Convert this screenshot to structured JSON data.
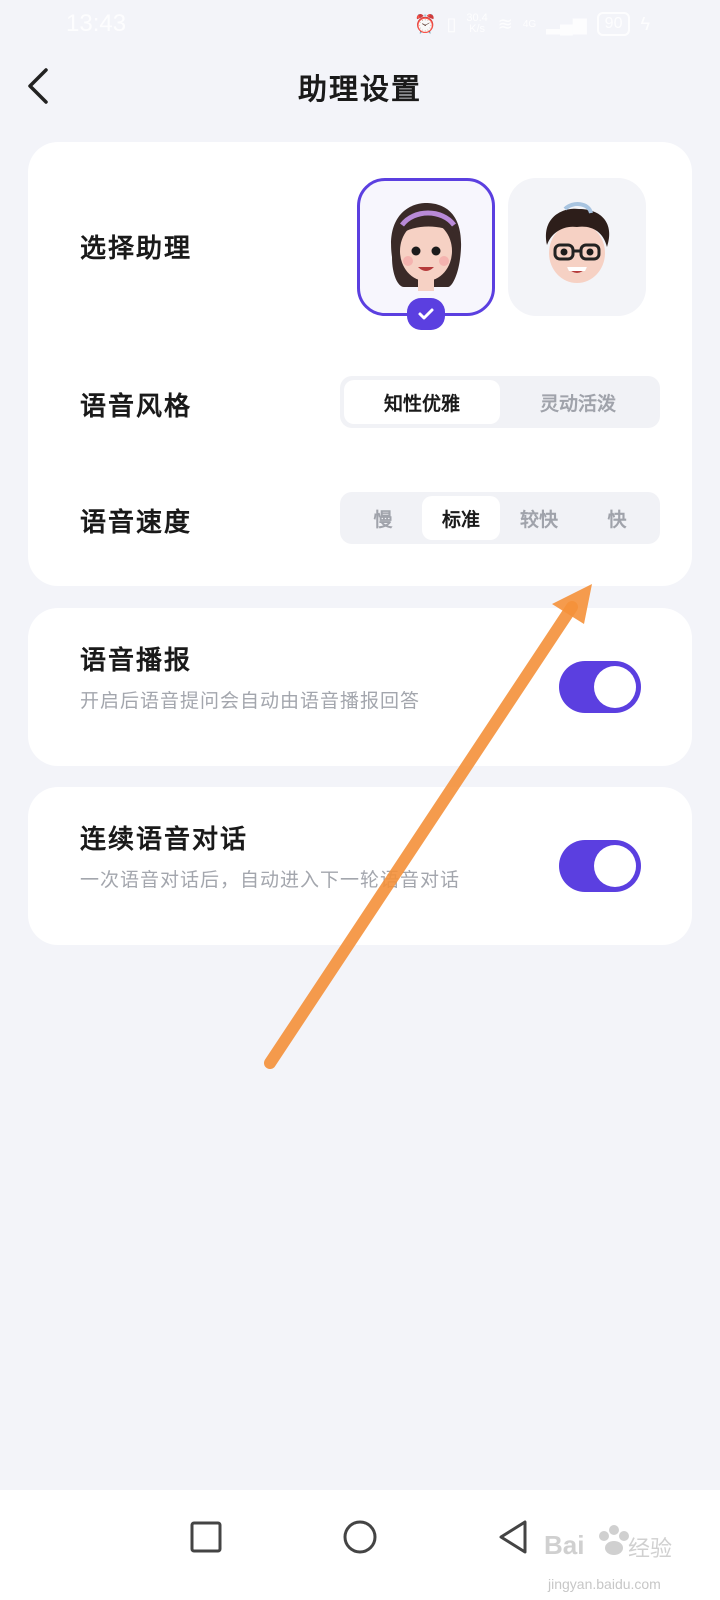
{
  "status_bar": {
    "time": "13:43",
    "network_speed_value": "30.4",
    "network_speed_unit": "K/s",
    "battery": "90",
    "network_type": "4G"
  },
  "header": {
    "title": "助理设置",
    "back_icon": "chevron-left-icon"
  },
  "assistant": {
    "label": "选择助理",
    "avatars": [
      {
        "name": "female-avatar",
        "selected": true
      },
      {
        "name": "male-avatar",
        "selected": false
      }
    ]
  },
  "voice_style": {
    "label": "语音风格",
    "options": [
      "知性优雅",
      "灵动活泼"
    ],
    "selected": "知性优雅"
  },
  "voice_speed": {
    "label": "语音速度",
    "options": [
      "慢",
      "标准",
      "较快",
      "快"
    ],
    "selected": "标准"
  },
  "broadcast": {
    "label": "语音播报",
    "description": "开启后语音提问会自动由语音播报回答",
    "enabled": true
  },
  "continuous": {
    "label": "连续语音对话",
    "description": "一次语音对话后，自动进入下一轮语音对话",
    "enabled": true
  },
  "nav_bar": {
    "buttons": [
      "recents-square-icon",
      "home-circle-icon",
      "back-triangle-icon"
    ]
  },
  "watermark": {
    "logo": "Bai经验",
    "url": "jingyan.baidu.com"
  },
  "colors": {
    "accent": "#5b3fe0",
    "annotation_arrow": "#f5913a",
    "background": "#f3f4f9"
  }
}
